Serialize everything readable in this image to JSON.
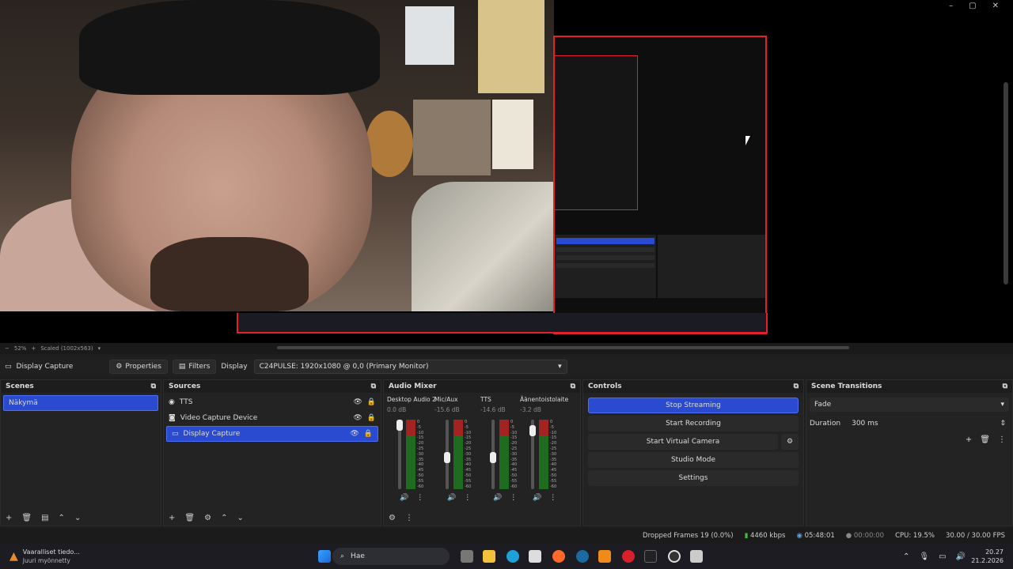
{
  "window": {
    "minimize": "–",
    "maximize": "▢",
    "close": "✕"
  },
  "zoom": {
    "minus": "−",
    "percent": "52%",
    "plus": "+",
    "scaled": "Scaled (1002x563)"
  },
  "props": {
    "source_name": "Display Capture",
    "properties": "Properties",
    "filters": "Filters",
    "display_label": "Display",
    "display_value": "C24PULSE: 1920x1080 @ 0,0 (Primary Monitor)"
  },
  "scenes": {
    "title": "Scenes",
    "items": [
      "Näkymä"
    ]
  },
  "sources": {
    "title": "Sources",
    "items": [
      "TTS",
      "Video Capture Device",
      "Display Capture"
    ]
  },
  "mixer": {
    "title": "Audio Mixer",
    "channels": [
      {
        "name": "Desktop Audio 2",
        "db": "0.0 dB",
        "level": 0.0
      },
      {
        "name": "Mic/Aux",
        "db": "-15.6 dB",
        "level": 0.55
      },
      {
        "name": "TTS",
        "db": "-14.6 dB",
        "level": 0.55
      },
      {
        "name": "Äänentoistolaite",
        "db": "-3.2 dB",
        "level": 0.1
      }
    ],
    "scale": [
      "0",
      "-5",
      "-10",
      "-15",
      "-20",
      "-25",
      "-30",
      "-35",
      "-40",
      "-45",
      "-50",
      "-55",
      "-60"
    ]
  },
  "controls": {
    "title": "Controls",
    "stop_streaming": "Stop Streaming",
    "start_recording": "Start Recording",
    "start_virtual_camera": "Start Virtual Camera",
    "studio_mode": "Studio Mode",
    "settings": "Settings"
  },
  "transitions": {
    "title": "Scene Transitions",
    "selected": "Fade",
    "duration_label": "Duration",
    "duration_value": "300 ms"
  },
  "status": {
    "dropped": "Dropped Frames 19 (0.0%)",
    "bitrate": "4460 kbps",
    "stream_time": "05:48:01",
    "rec_time": "00:00:00",
    "cpu": "CPU: 19.5%",
    "fps": "30.00 / 30.00 FPS"
  },
  "taskbar": {
    "notif_title": "Vaaralliset tiedo...",
    "notif_sub": "Juuri myönnetty",
    "search": "Hae",
    "time": "20.27",
    "date": "21.2.2026"
  },
  "colors": {
    "accent": "#2a4bd0",
    "preview_border": "#e5202e",
    "panel": "#232323"
  }
}
